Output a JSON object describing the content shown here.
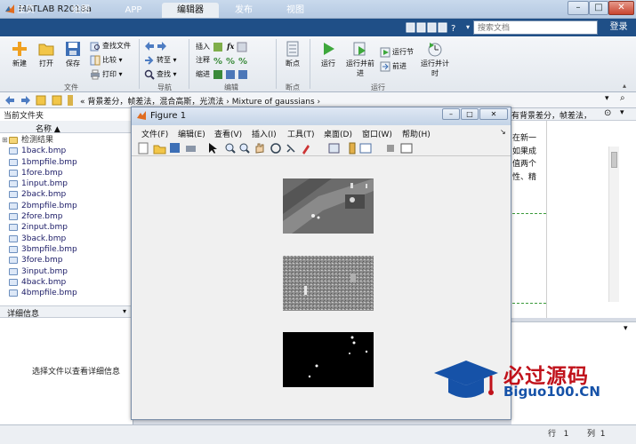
{
  "app": {
    "title": "MATLAB R2018a"
  },
  "window_controls": {
    "minimize": "–",
    "maximize": "□",
    "close": "✕"
  },
  "tabs": [
    {
      "label": "主页"
    },
    {
      "label": "绘图"
    },
    {
      "label": "APP"
    },
    {
      "label": "编辑器"
    },
    {
      "label": "发布"
    },
    {
      "label": "视图"
    }
  ],
  "search": {
    "placeholder": "搜索文档"
  },
  "login": "登录",
  "toolstrip": {
    "file": {
      "new": "新建",
      "open": "打开",
      "save": "保存",
      "find_files": "查找文件",
      "compare": "比较",
      "print": "打印",
      "group": "文件"
    },
    "nav": {
      "goto": "转至",
      "find": "查找",
      "group": "导航"
    },
    "edit": {
      "insert": "插入",
      "fx": "fx",
      "comment": "注释",
      "indent": "缩进",
      "group": "编辑"
    },
    "breakpoints": {
      "label": "断点",
      "group": "断点"
    },
    "run": {
      "run": "运行",
      "run_advance": "运行并前进",
      "run_section": "运行节",
      "advance": "前进",
      "run_time": "运行并计时",
      "group": "运行"
    }
  },
  "address": {
    "path": "« 背景差分，帧差法，混合高斯，光流法 › Mixture of gaussians ›"
  },
  "current_folder": {
    "title": "当前文件夹",
    "col_name": "名称 ▲",
    "folder": "检测结果",
    "files": [
      "1back.bmp",
      "1bmpfile.bmp",
      "1fore.bmp",
      "1input.bmp",
      "2back.bmp",
      "2bmpfile.bmp",
      "2fore.bmp",
      "2input.bmp",
      "3back.bmp",
      "3bmpfile.bmp",
      "3fore.bmp",
      "3input.bmp",
      "4back.bmp",
      "4bmpfile.bmp"
    ]
  },
  "details": {
    "title": "详细信息",
    "message": "选择文件以查看详细信息"
  },
  "editor_panel": {
    "tab_text": "有背景差分，帧差法，",
    "lines": [
      "在新一",
      "如果成",
      "值两个",
      "性、精"
    ]
  },
  "figure": {
    "title": "Figure 1",
    "menus": [
      "文件(F)",
      "编辑(E)",
      "查看(V)",
      "插入(I)",
      "工具(T)",
      "桌面(D)",
      "窗口(W)",
      "帮助(H)"
    ]
  },
  "status": {
    "row_label": "行",
    "row": "1",
    "col_label": "列",
    "col": "1"
  },
  "watermark": {
    "text": "必过源码",
    "url": "Biguo100.CN"
  }
}
